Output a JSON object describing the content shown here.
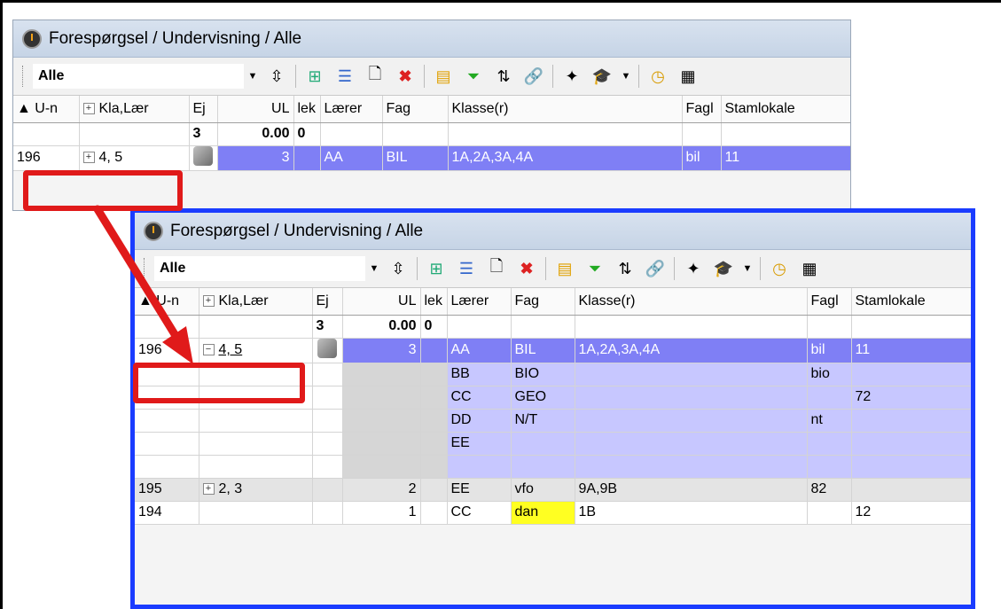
{
  "window_title": "Forespørgsel / Undervisning / Alle",
  "filter": {
    "value": "Alle"
  },
  "toolbar_icons": [
    "spin-icon",
    "grid-add-icon",
    "list-icon",
    "new-icon",
    "delete-icon",
    "ruler-icon",
    "filter-icon",
    "sort-icon",
    "link-icon",
    "magic-icon",
    "hat-icon",
    "clock-icon",
    "calendar-icon"
  ],
  "columns": [
    "U-n",
    "Kla,Lær",
    "Ej",
    "UL",
    "lek",
    "Lærer",
    "Fag",
    "Klasse(r)",
    "Fagl",
    "Stamlokale"
  ],
  "columns2_first": "U-n",
  "summary": {
    "ej": "3",
    "ul": "0.00",
    "lek": "0"
  },
  "top_row": {
    "un": "196",
    "kla": "4, 5",
    "ul": "3",
    "laerer": "AA",
    "fag": "BIL",
    "klasse": "1A,2A,3A,4A",
    "fagl": "bil",
    "stam": "11"
  },
  "sub_rows": [
    {
      "laerer": "BB",
      "fag": "BIO",
      "fagl": "bio",
      "stam": ""
    },
    {
      "laerer": "CC",
      "fag": "GEO",
      "fagl": "",
      "stam": "72"
    },
    {
      "laerer": "DD",
      "fag": "N/T",
      "fagl": "nt",
      "stam": ""
    },
    {
      "laerer": "EE",
      "fag": "",
      "fagl": "",
      "stam": ""
    },
    {
      "laerer": "",
      "fag": "",
      "fagl": "",
      "stam": ""
    }
  ],
  "row_195": {
    "un": "195",
    "kla": "2, 3",
    "ul": "2",
    "laerer": "EE",
    "fag": "vfo",
    "klasse": "9A,9B",
    "fagl": "82",
    "stam": ""
  },
  "row_194": {
    "un": "194",
    "kla": "",
    "ul": "1",
    "laerer": "CC",
    "fag": "dan",
    "klasse": "1B",
    "fagl": "",
    "stam": "12"
  },
  "colors": {
    "selected": "#7f7ff5",
    "subrow": "#c7c7ff",
    "callout": "#e01a1a",
    "frame": "#1a3cff"
  }
}
